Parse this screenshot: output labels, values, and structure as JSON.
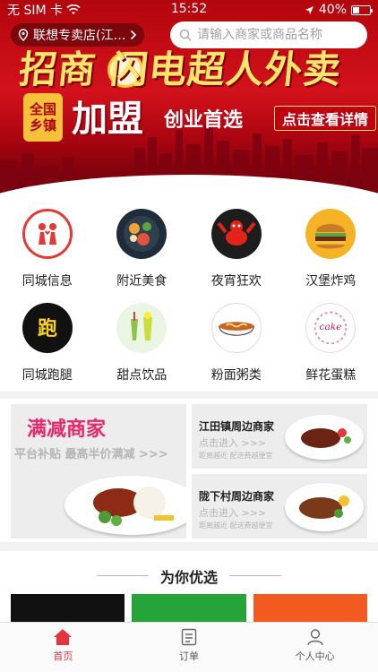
{
  "status_bar": {
    "carrier": "无 SIM 卡",
    "time": "15:52",
    "battery_text": "40%",
    "battery_level": 0.4
  },
  "header": {
    "location_label": "联想专卖店(江…",
    "search_placeholder": "请输入商家或商品名称"
  },
  "banner": {
    "headline": "招商 闪电超人外卖",
    "badge": "全国乡镇",
    "join": "加盟",
    "slogan": "创业首选",
    "cta": "点击查看详情"
  },
  "categories": [
    {
      "label": "同城信息",
      "icon": "couple-heart-icon"
    },
    {
      "label": "附近美食",
      "icon": "food-bowl-icon"
    },
    {
      "label": "夜宵狂欢",
      "icon": "crayfish-icon"
    },
    {
      "label": "汉堡炸鸡",
      "icon": "burger-icon"
    },
    {
      "label": "同城跑腿",
      "icon": "run-icon"
    },
    {
      "label": "甜点饮品",
      "icon": "drinks-icon"
    },
    {
      "label": "粉面粥类",
      "icon": "noodles-icon"
    },
    {
      "label": "鲜花蛋糕",
      "icon": "cake-flower-icon"
    }
  ],
  "promo": {
    "main": {
      "title": "满减商家",
      "subtitle": "平台补贴 最高半价满减 >>>"
    },
    "side": [
      {
        "title": "江田镇周边商家",
        "enter": "点击进入 >>>",
        "note": "距离越近 配送费越便宜"
      },
      {
        "title": "陇下村周边商家",
        "enter": "点击进入 >>>",
        "note": "距离越近 配送费越便宜"
      }
    ]
  },
  "recommend": {
    "title": "为你优选"
  },
  "tabbar": {
    "items": [
      {
        "label": "首页",
        "icon": "home-icon",
        "active": true
      },
      {
        "label": "订单",
        "icon": "order-icon",
        "active": false
      },
      {
        "label": "个人中心",
        "icon": "user-icon",
        "active": false
      }
    ]
  },
  "colors": {
    "accent": "#e33540",
    "banner_red": "#c8101a",
    "promo_pink": "#e6286d"
  }
}
